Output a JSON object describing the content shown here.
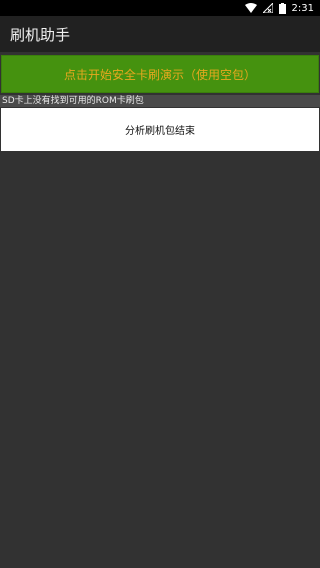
{
  "status_bar": {
    "time": "2:31",
    "icons": [
      "wifi-icon",
      "signal-off-icon",
      "battery-icon"
    ]
  },
  "app_bar": {
    "title": "刷机助手"
  },
  "main": {
    "start_button_label": "点击开始安全卡刷演示（使用空包）",
    "notice_text": "SD卡上没有找到可用的ROM卡刷包",
    "result_text": "分析刷机包结束"
  },
  "colors": {
    "status_bar": "#000000",
    "app_bar": "#212121",
    "background": "#323232",
    "button_green": "#45920f",
    "button_text": "#e6a81e",
    "notice_bar": "#4a4a4a",
    "result_box": "#ffffff"
  }
}
